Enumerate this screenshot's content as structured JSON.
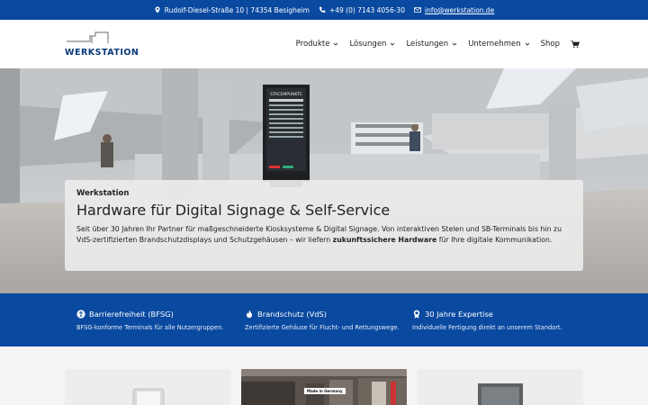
{
  "topbar": {
    "address": "Rudolf-Diesel-Straße 10 | 74354 Besigheim",
    "phone": "+49 (0) 7143 4056-30",
    "email": "info@werkstation.de"
  },
  "header": {
    "logo_text": "WERKSTATION",
    "nav": [
      {
        "label": "Produkte",
        "dropdown": true
      },
      {
        "label": "Lösungen",
        "dropdown": true
      },
      {
        "label": "Leistungen",
        "dropdown": true
      },
      {
        "label": "Unternehmen",
        "dropdown": true
      },
      {
        "label": "Shop",
        "dropdown": false
      }
    ],
    "cart_icon": "cart-icon"
  },
  "hero": {
    "eyebrow": "Werkstation",
    "title": "Hardware für Digital Signage & Self-Service",
    "text_before": "Seit über 30 Jahren Ihr Partner für maßgeschneiderte Kiosksysteme & Digital Signage. Von interaktiven Stelen und SB-Terminals bis hin zu VdS-zertifizierten Brandschutzdisplays und Schutzgehäusen – wir liefern ",
    "text_bold": "zukunftssichere Hardware",
    "text_after": " für Ihre digitale Kommunikation.",
    "screen_heading": "STACEMPUNKTE"
  },
  "features": [
    {
      "icon": "accessibility-icon",
      "title": "Barrierefreiheit (BFSG)",
      "desc": "BFSG-konforme Terminals für alle Nutzergruppen."
    },
    {
      "icon": "flame-icon",
      "title": "Brandschutz (VdS)",
      "desc": "Zertifizierte Gehäuse für Flucht- und Rettungswege."
    },
    {
      "icon": "award-icon",
      "title": "30 Jahre Expertise",
      "desc": "Individuelle Fertigung direkt an unserem Standort."
    }
  ],
  "cards": {
    "made_in_germany": "Made in Germany"
  },
  "colors": {
    "brand_blue": "#0a49a0",
    "logo_blue": "#0a3a7a"
  }
}
